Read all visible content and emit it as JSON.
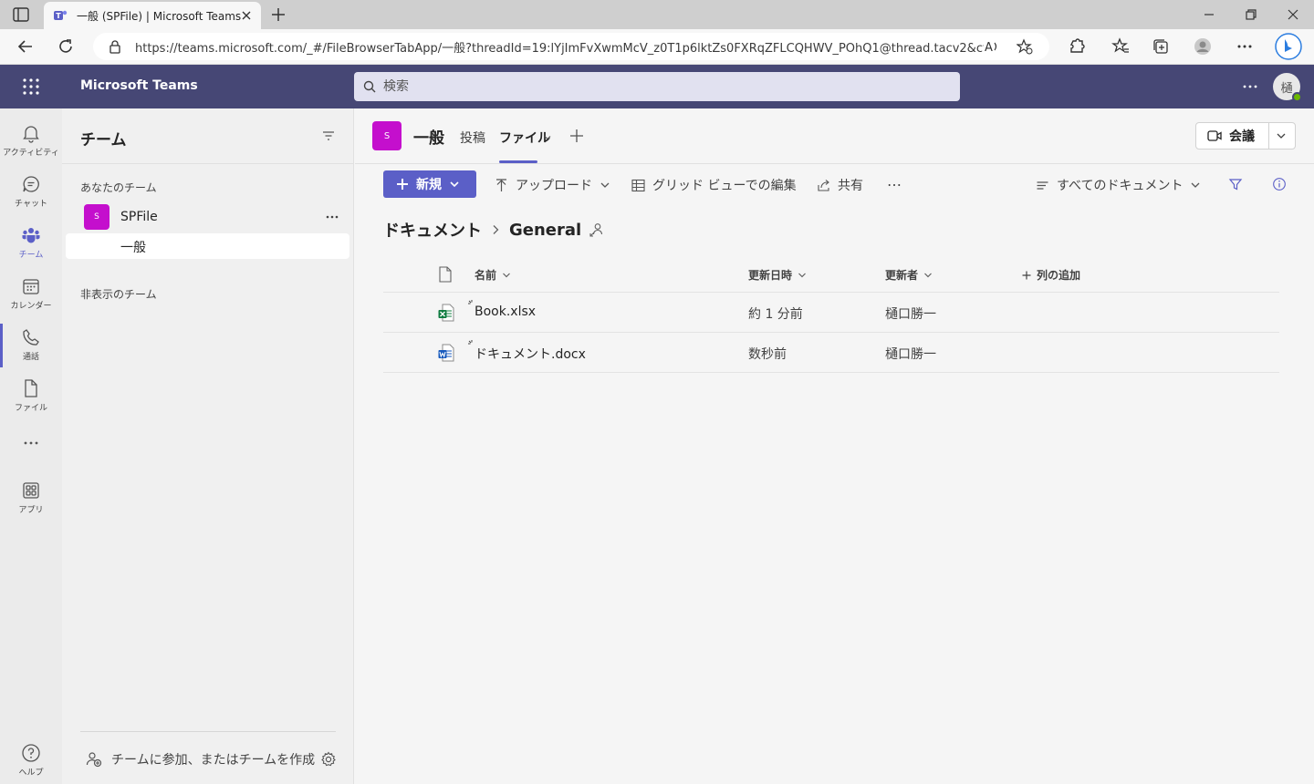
{
  "browser": {
    "tab_title": "一般 (SPFile) | Microsoft Teams",
    "url": "https://teams.microsoft.com/_#/FileBrowserTabApp/一般?threadId=19:lYjImFvXwmMcV_z0T1p6lktZs0FXRqZFLCQHWV_POhQ1@thread.tacv2&ctx=c..."
  },
  "header": {
    "app_name": "Microsoft Teams",
    "search_placeholder": "検索",
    "avatar_initial": "樋"
  },
  "rail": {
    "items": [
      {
        "label": "アクティビティ",
        "icon": "bell-icon"
      },
      {
        "label": "チャット",
        "icon": "chat-icon"
      },
      {
        "label": "チーム",
        "icon": "teams-icon"
      },
      {
        "label": "カレンダー",
        "icon": "calendar-icon"
      },
      {
        "label": "通話",
        "icon": "phone-icon"
      },
      {
        "label": "ファイル",
        "icon": "file-icon"
      },
      {
        "label": "アプリ",
        "icon": "apps-icon"
      },
      {
        "label": "ヘルプ",
        "icon": "help-icon"
      }
    ]
  },
  "teams_panel": {
    "title": "チーム",
    "your_teams": "あなたのチーム",
    "team": {
      "tile": "S",
      "name": "SPFile"
    },
    "channel": "一般",
    "hidden_teams": "非表示のチーム",
    "join_create": "チームに参加、またはチームを作成"
  },
  "channel": {
    "tile": "S",
    "name": "一般",
    "tabs": [
      "投稿",
      "ファイル"
    ],
    "meet_label": "会議"
  },
  "commands": {
    "new": "新規",
    "upload": "アップロード",
    "grid_edit": "グリッド ビューでの編集",
    "share": "共有",
    "more": "…",
    "view": "すべてのドキュメント"
  },
  "breadcrumb": {
    "root": "ドキュメント",
    "current": "General"
  },
  "table": {
    "columns": {
      "name": "名前",
      "modified": "更新日時",
      "modified_by": "更新者",
      "add": "列の追加"
    },
    "rows": [
      {
        "name": "Book.xlsx",
        "modified": "約 1 分前",
        "modified_by": "樋口勝一",
        "type": "excel"
      },
      {
        "name": "ドキュメント.docx",
        "modified": "数秒前",
        "modified_by": "樋口勝一",
        "type": "word"
      }
    ]
  },
  "colors": {
    "header": "#464775",
    "accent": "#5b5fc7",
    "team_tile": "#c40fcd",
    "excel": "#107c41",
    "word": "#185abd"
  }
}
